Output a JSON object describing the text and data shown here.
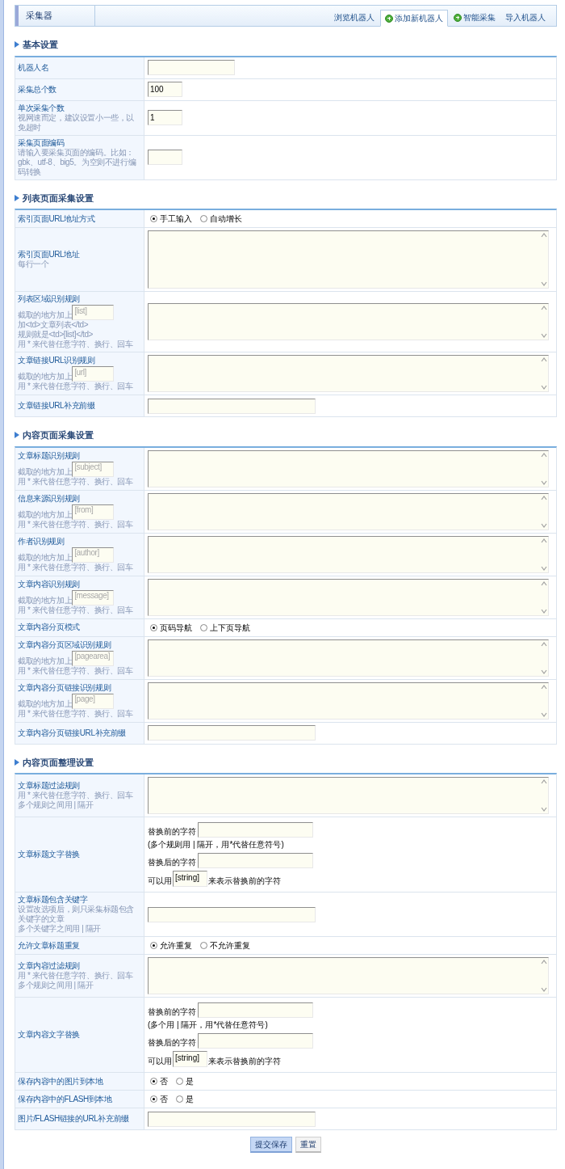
{
  "header": {
    "title": "采集器",
    "tabs": [
      {
        "label": "浏览机器人",
        "selected": false,
        "kind": "plain"
      },
      {
        "label": "添加新机器人",
        "selected": true,
        "kind": "add"
      },
      {
        "label": "智能采集",
        "selected": false,
        "kind": "add"
      },
      {
        "label": "导入机器人",
        "selected": false,
        "kind": "plain"
      }
    ]
  },
  "sections": [
    {
      "title": "基本设置",
      "rows": [
        {
          "label": "机器人名",
          "control": {
            "kind": "text"
          }
        },
        {
          "label": "采集总个数",
          "control": {
            "kind": "short_text",
            "value": "100"
          }
        },
        {
          "label": "单次采集个数",
          "hints": [
            {
              "text": "视网速而定，建议设置小一些，以免超时"
            }
          ],
          "control": {
            "kind": "short_text",
            "value": "1"
          }
        },
        {
          "label": "采集页面编码",
          "hints": [
            {
              "text": "请输入要采集页面的编码。比如：gbk、utf-8、big5。为空则不进行编码转换"
            }
          ],
          "control": {
            "kind": "short_text"
          }
        }
      ]
    },
    {
      "title": "列表页面采集设置",
      "rows": [
        {
          "label": "索引页面URL地址方式",
          "control": {
            "kind": "radio",
            "options": [
              {
                "label": "手工输入",
                "selected": true
              },
              {
                "label": "自动增长",
                "selected": false
              }
            ]
          }
        },
        {
          "label": "索引页面URL地址",
          "hints": [
            {
              "text": "每行一个"
            }
          ],
          "control": {
            "kind": "textarea",
            "tall": true
          }
        },
        {
          "label": "列表区域识别规则",
          "hints": [
            {
              "text": "截取的地方加上",
              "placeholder": "[list]"
            },
            {
              "text": "加<td>文章列表</td>"
            },
            {
              "text": "规则就是<td>[list]</td>"
            },
            {
              "text": "用 * 来代替任意字符、换行、回车"
            }
          ],
          "control": {
            "kind": "textarea",
            "tall": false
          }
        },
        {
          "label": "文章链接URL识别规则",
          "hints": [
            {
              "text": "截取的地方加上",
              "placeholder": "[url]"
            },
            {
              "text": "用 * 来代替任意字符、换行、回车"
            }
          ],
          "control": {
            "kind": "textarea",
            "tall": false
          }
        },
        {
          "label": "文章链接URL补充前缀",
          "control": {
            "kind": "long_text"
          }
        }
      ]
    },
    {
      "title": "内容页面采集设置",
      "rows": [
        {
          "label": "文章标题识别规则",
          "hints": [
            {
              "text": "截取的地方加上",
              "placeholder": "[subject]"
            },
            {
              "text": "用 * 来代替任意字符、换行、回车"
            }
          ],
          "control": {
            "kind": "textarea",
            "tall": false
          }
        },
        {
          "label": "信息来源识别规则",
          "hints": [
            {
              "text": "截取的地方加上",
              "placeholder": "[from]"
            },
            {
              "text": "用 * 来代替任意字符、换行、回车"
            }
          ],
          "control": {
            "kind": "textarea",
            "tall": false
          }
        },
        {
          "label": "作者识别规则",
          "hints": [
            {
              "text": "截取的地方加上",
              "placeholder": "[author]"
            },
            {
              "text": "用 * 来代替任意字符、换行、回车"
            }
          ],
          "control": {
            "kind": "textarea",
            "tall": false
          }
        },
        {
          "label": "文章内容识别规则",
          "hints": [
            {
              "text": "截取的地方加上",
              "placeholder": "[message]"
            },
            {
              "text": "用 * 来代替任意字符、换行、回车"
            }
          ],
          "control": {
            "kind": "textarea",
            "tall": false
          }
        },
        {
          "label": "文章内容分页模式",
          "control": {
            "kind": "radio",
            "options": [
              {
                "label": "页码导航",
                "selected": true
              },
              {
                "label": "上下页导航",
                "selected": false
              }
            ]
          }
        },
        {
          "label": "文章内容分页区域识别规则",
          "hints": [
            {
              "text": "截取的地方加上",
              "placeholder": "[pagearea]"
            },
            {
              "text": "用 * 来代替任意字符、换行、回车"
            }
          ],
          "control": {
            "kind": "textarea",
            "tall": false
          }
        },
        {
          "label": "文章内容分页链接识别规则",
          "hints": [
            {
              "text": "截取的地方加上",
              "placeholder": "[page]"
            },
            {
              "text": "用 * 来代替任意字符、换行、回车"
            }
          ],
          "control": {
            "kind": "textarea",
            "tall": false
          }
        },
        {
          "label": "文章内容分页链接URL补充前缀",
          "control": {
            "kind": "long_text"
          }
        }
      ]
    },
    {
      "title": "内容页面整理设置",
      "rows": [
        {
          "label": "文章标题过滤规则",
          "hints": [
            {
              "text": "用 * 来代替任意字符、换行、回车"
            },
            {
              "text": "多个规则之间用 | 隔开"
            }
          ],
          "control": {
            "kind": "textarea",
            "tall": false
          }
        },
        {
          "label": "文章标题文字替换",
          "control": {
            "kind": "replace",
            "before_label": "替换前的字符",
            "note": "(多个规则用 | 隔开，用*代替任意符号)",
            "after_label": "替换后的字符",
            "usage_before": "可以用",
            "usage_value": "[string]",
            "usage_after": "来表示替换前的字符"
          }
        },
        {
          "label": "文章标题包含关键字",
          "hints": [
            {
              "text": "设置改选项后，则只采集标题包含关键字的文章"
            },
            {
              "text": "多个关键字之间用 | 隔开"
            }
          ],
          "control": {
            "kind": "long_text"
          }
        },
        {
          "label": "允许文章标题重复",
          "control": {
            "kind": "radio",
            "options": [
              {
                "label": "允许重复",
                "selected": true
              },
              {
                "label": "不允许重复",
                "selected": false
              }
            ]
          }
        },
        {
          "label": "文章内容过滤规则",
          "hints": [
            {
              "text": "用 * 来代替任意字符、换行、回车"
            },
            {
              "text": "多个规则之间用 | 隔开"
            }
          ],
          "control": {
            "kind": "textarea",
            "tall": false
          }
        },
        {
          "label": "文章内容文字替换",
          "control": {
            "kind": "replace",
            "before_label": "替换前的字符",
            "note": "(多个用 | 隔开，用*代替任意符号)",
            "after_label": "替换后的字符",
            "usage_before": "可以用",
            "usage_value": "[string]",
            "usage_after": "来表示替换前的字符"
          }
        },
        {
          "label": "保存内容中的图片到本地",
          "control": {
            "kind": "radio",
            "options": [
              {
                "label": "否",
                "selected": true
              },
              {
                "label": "是",
                "selected": false
              }
            ]
          }
        },
        {
          "label": "保存内容中的FLASH到本地",
          "control": {
            "kind": "radio",
            "options": [
              {
                "label": "否",
                "selected": true
              },
              {
                "label": "是",
                "selected": false
              }
            ]
          }
        },
        {
          "label": "图片/FLASH链接的URL补充前缀",
          "control": {
            "kind": "long_text"
          }
        }
      ]
    }
  ],
  "buttons": [
    {
      "label": "提交保存",
      "kind": "primary"
    },
    {
      "label": "重置",
      "kind": "secondary"
    }
  ]
}
